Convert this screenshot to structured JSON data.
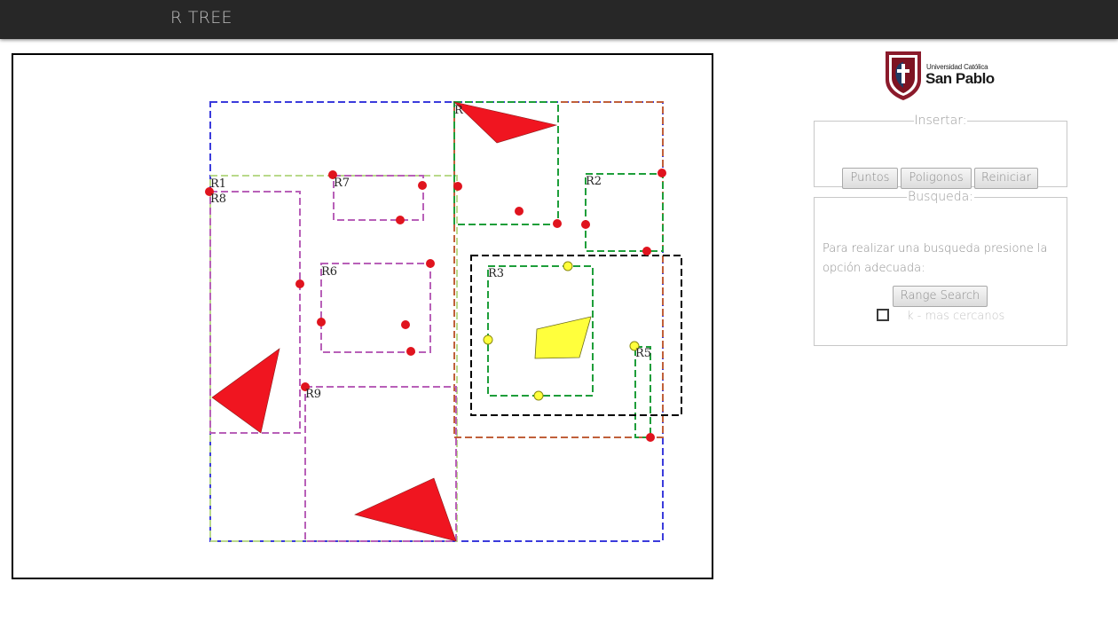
{
  "navbar": {
    "title": "R TREE"
  },
  "logo": {
    "line1": "Universidad Católica",
    "line2": "San Pablo"
  },
  "insert_panel": {
    "legend": "Insertar:",
    "buttons": {
      "points": "Puntos",
      "polygons": "Poligonos",
      "reset": "Reiniciar"
    }
  },
  "search_panel": {
    "legend": "Busqueda:",
    "help_text": "Para realizar una busqueda presione la opción adecuada:",
    "range_search_button": "Range Search",
    "knn_label": "k - mas cercanos",
    "knn_checked": false
  },
  "canvas": {
    "region_labels": {
      "r1": "R1",
      "r2": "R2",
      "r3": "R3",
      "r5": "R5",
      "r6": "R6",
      "r7": "R7",
      "r8": "R8",
      "r9": "R9",
      "r_top": "R"
    },
    "colors": {
      "root": "#3b3bdc",
      "level1_a": "#b9d98a",
      "level1_b": "#c0603a",
      "leaf_pink": "#b860b8",
      "leaf_green": "#1e9e3a",
      "query": "#000000",
      "point": "#e0141e",
      "highlight": "#ffff3c"
    }
  }
}
